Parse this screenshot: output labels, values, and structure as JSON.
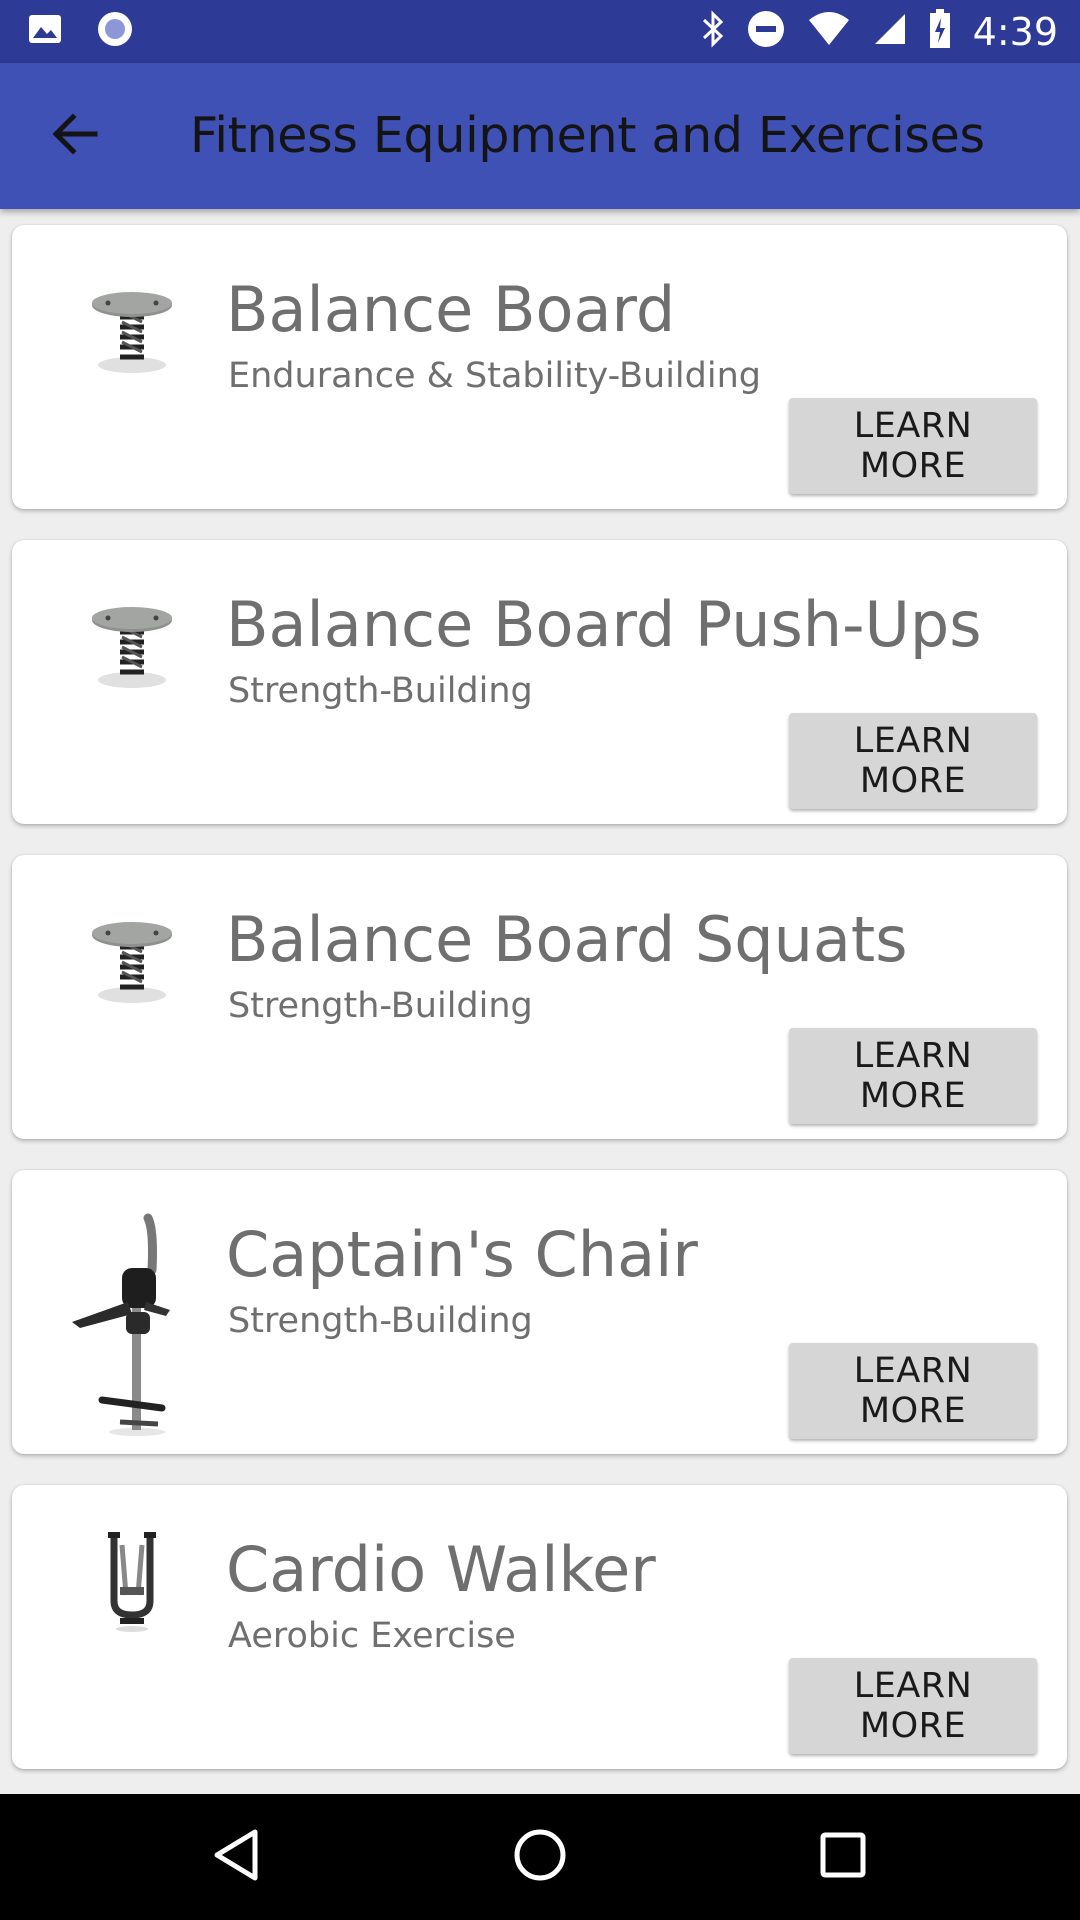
{
  "status_bar": {
    "time": "4:39",
    "left_icons": [
      "image-icon",
      "record-icon"
    ],
    "right_icons": [
      "bluetooth-icon",
      "do-not-disturb-icon",
      "wifi-icon",
      "signal-icon",
      "battery-charging-icon"
    ]
  },
  "app_bar": {
    "title": "Fitness Equipment and Exercises",
    "back_icon": "arrow-back-icon"
  },
  "items": [
    {
      "title": "Balance Board",
      "subtitle": "Endurance & Stability-Building",
      "button": "LEARN MORE",
      "image": "balance-board-image"
    },
    {
      "title": "Balance Board Push-Ups",
      "subtitle": "Strength-Building",
      "button": "LEARN MORE",
      "image": "balance-board-image"
    },
    {
      "title": "Balance Board Squats",
      "subtitle": "Strength-Building",
      "button": "LEARN MORE",
      "image": "balance-board-image"
    },
    {
      "title": "Captain's Chair",
      "subtitle": "Strength-Building",
      "button": "LEARN MORE",
      "image": "captains-chair-image"
    },
    {
      "title": "Cardio Walker",
      "subtitle": "Aerobic Exercise",
      "button": "LEARN MORE",
      "image": "cardio-walker-image"
    }
  ],
  "nav_bar": {
    "icons": [
      "back-triangle-icon",
      "home-circle-icon",
      "recents-square-icon"
    ]
  },
  "colors": {
    "status_bar": "#2d3a96",
    "app_bar": "#3f51b5",
    "button": "#d6d6d6",
    "text_secondary": "#6f6f6f"
  }
}
